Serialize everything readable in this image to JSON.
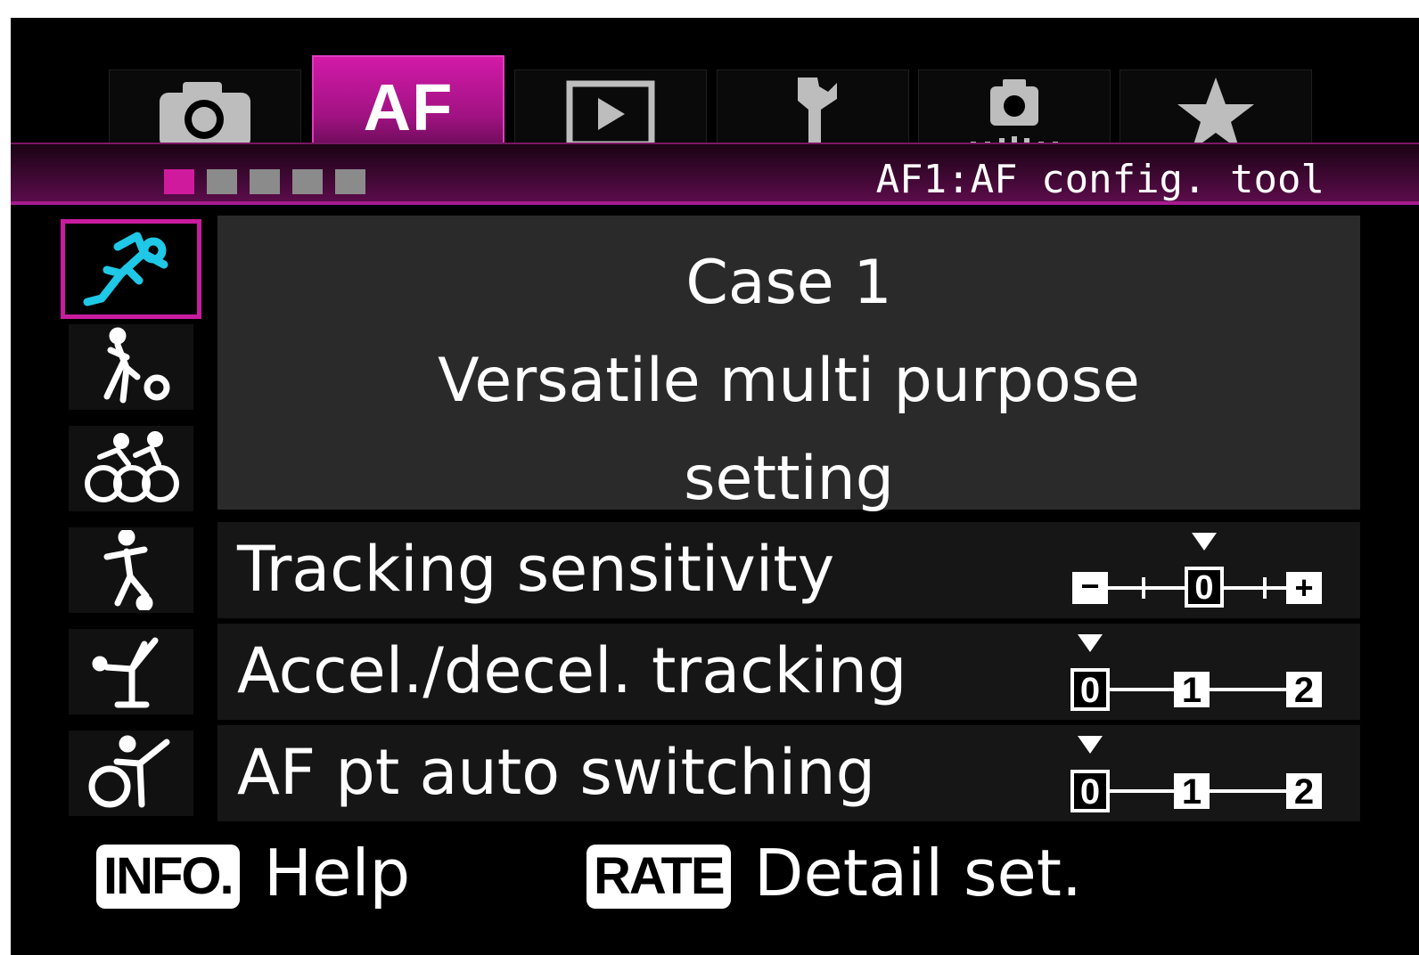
{
  "tabs": [
    {
      "icon": "camera-icon",
      "active": false
    },
    {
      "label": "AF",
      "active": true
    },
    {
      "icon": "playback-icon",
      "active": false
    },
    {
      "icon": "wrench-icon",
      "active": false
    },
    {
      "icon": "custom-camera-icon",
      "active": false
    },
    {
      "icon": "star-icon",
      "active": false
    }
  ],
  "header": {
    "page_count": 5,
    "current_page": 1,
    "title": "AF1:AF config. tool"
  },
  "sidebar": {
    "cases": [
      "case-1-icon",
      "case-2-icon",
      "case-3-icon",
      "case-4-icon",
      "case-5-icon",
      "case-6-icon"
    ],
    "selected": 1
  },
  "case": {
    "name": "Case 1",
    "desc_line1": "Versatile multi purpose",
    "desc_line2": "setting"
  },
  "settings": [
    {
      "label": "Tracking sensitivity",
      "scale": [
        "−",
        "0",
        "+"
      ],
      "value": 0
    },
    {
      "label": "Accel./decel. tracking",
      "scale": [
        "0",
        "1",
        "2"
      ],
      "value": 0
    },
    {
      "label": "AF pt auto switching",
      "scale": [
        "0",
        "1",
        "2"
      ],
      "value": 0
    }
  ],
  "footer": {
    "info_badge": "INFO.",
    "info_text": "Help",
    "rate_badge": "RATE",
    "rate_text": "Detail set."
  },
  "colors": {
    "accent": "#c81c9e",
    "icon_selected": "#1ec8e6"
  }
}
